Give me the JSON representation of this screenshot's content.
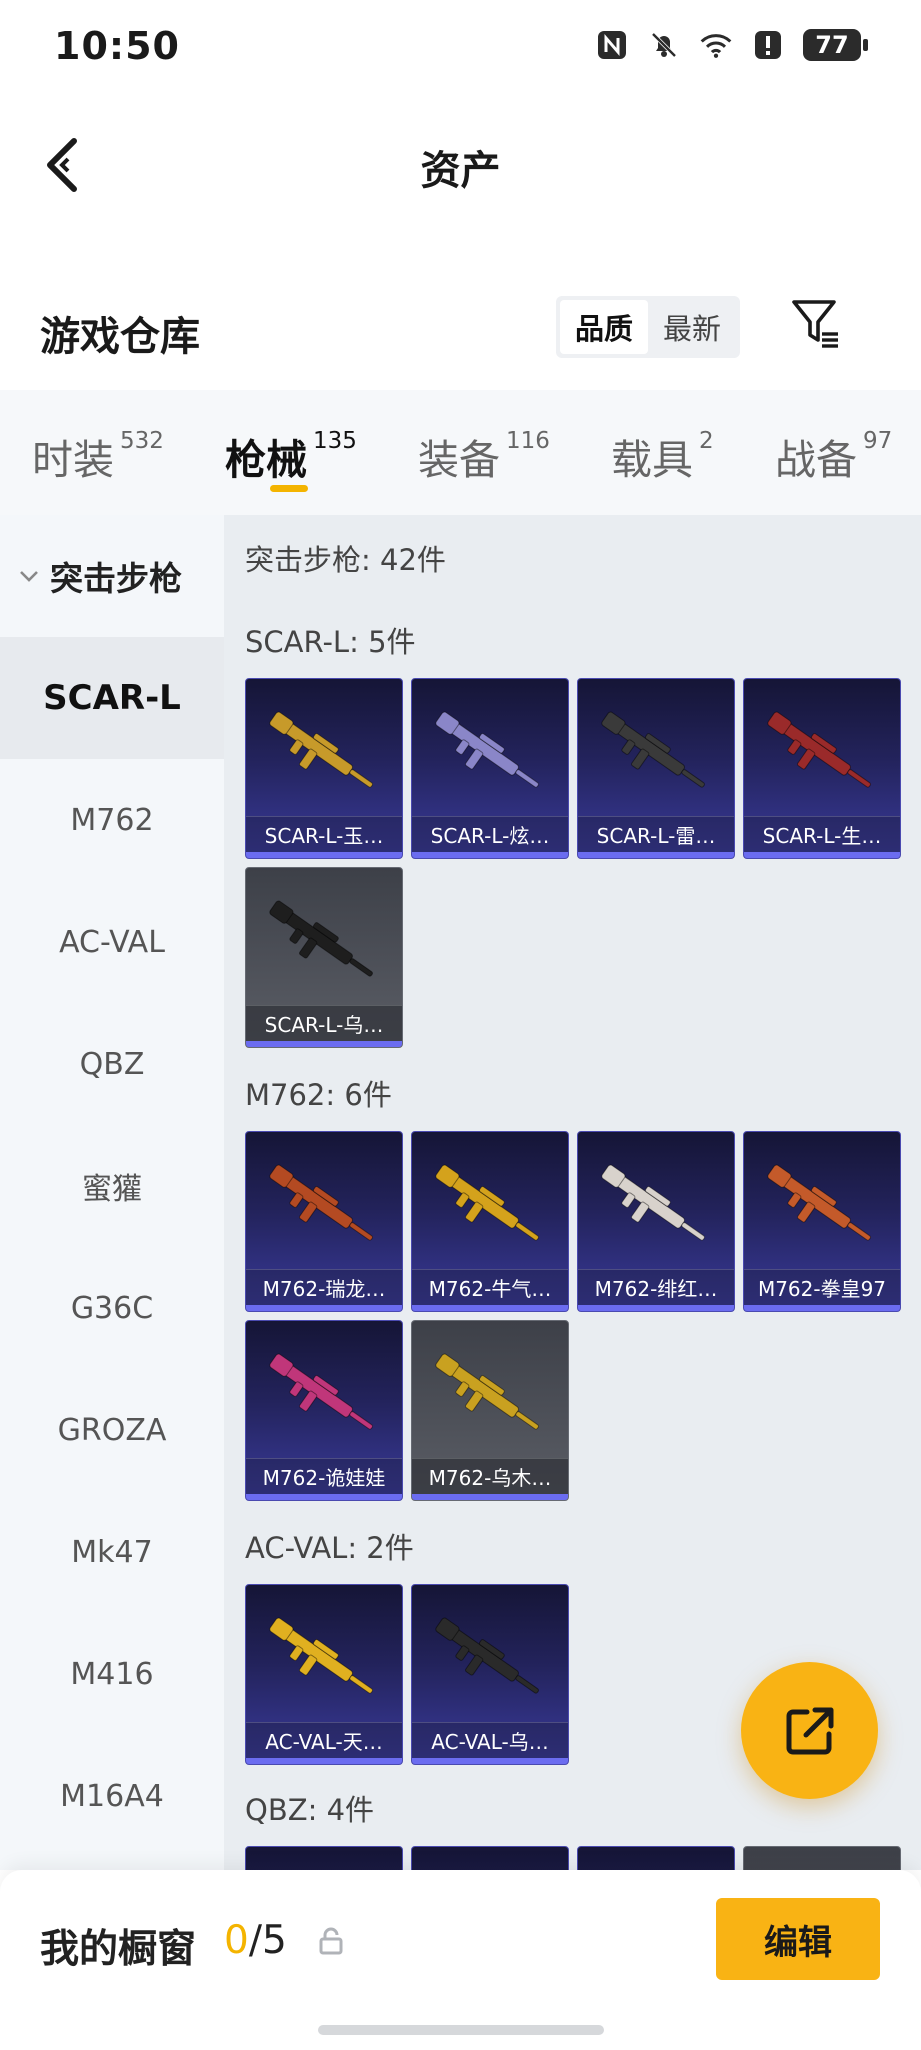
{
  "status_bar": {
    "time": "10:50",
    "battery": "77",
    "icons": [
      "nfc-icon",
      "bell-mute-icon",
      "wifi-icon",
      "alert-icon",
      "battery-icon"
    ]
  },
  "header": {
    "title": "资产",
    "back_icon": "chevron-left-icon"
  },
  "warehouse": {
    "title": "游戏仓库",
    "sort_options": [
      "品质",
      "最新"
    ],
    "sort_active": "品质",
    "filter_icon": "filter-icon"
  },
  "tabs": [
    {
      "label": "时装",
      "count": "532"
    },
    {
      "label": "枪械",
      "count": "135",
      "active": true
    },
    {
      "label": "装备",
      "count": "116"
    },
    {
      "label": "载具",
      "count": "2"
    },
    {
      "label": "战备",
      "count": "97"
    }
  ],
  "colors": {
    "accent": "#f9b314",
    "card_purple": "#3a3b9c",
    "card_gray": "#5b5e66",
    "panel_bg": "#e9edf1"
  },
  "sidebar": {
    "group": "突击步枪",
    "items": [
      "SCAR-L",
      "M762",
      "AC-VAL",
      "QBZ",
      "蜜獾",
      "G36C",
      "GROZA",
      "Mk47",
      "M416",
      "M16A4"
    ],
    "active": "SCAR-L"
  },
  "content": {
    "category_title": "突击步枪: 42件",
    "sections": [
      {
        "title": "SCAR-L: 5件",
        "items": [
          {
            "label": "SCAR-L-玉…",
            "style": "purple"
          },
          {
            "label": "SCAR-L-炫…",
            "style": "purple"
          },
          {
            "label": "SCAR-L-雷…",
            "style": "purple"
          },
          {
            "label": "SCAR-L-生…",
            "style": "purple"
          },
          {
            "label": "SCAR-L-乌…",
            "style": "gray"
          }
        ]
      },
      {
        "title": "M762: 6件",
        "items": [
          {
            "label": "M762-瑞龙…",
            "style": "purple"
          },
          {
            "label": "M762-牛气…",
            "style": "purple"
          },
          {
            "label": "M762-绯红…",
            "style": "purple"
          },
          {
            "label": "M762-拳皇97",
            "style": "purple"
          },
          {
            "label": "M762-诡娃娃",
            "style": "purple"
          },
          {
            "label": "M762-乌木…",
            "style": "gray"
          }
        ]
      },
      {
        "title": "AC-VAL: 2件",
        "items": [
          {
            "label": "AC-VAL-天…",
            "style": "purple"
          },
          {
            "label": "AC-VAL-乌…",
            "style": "purple"
          }
        ]
      },
      {
        "title": "QBZ: 4件",
        "items": []
      }
    ]
  },
  "fab": {
    "icon": "share-icon"
  },
  "bottom": {
    "showcase_label": "我的橱窗",
    "current": "0",
    "total": "/5",
    "edit_label": "编辑",
    "lock_icon": "lock-icon"
  }
}
